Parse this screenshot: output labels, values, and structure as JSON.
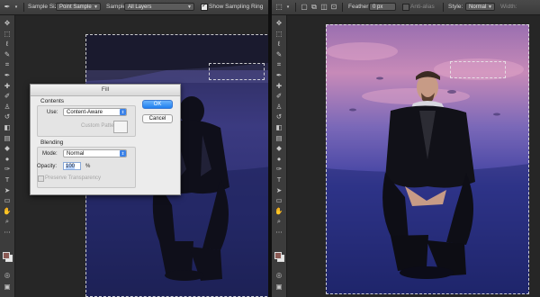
{
  "left_options": {
    "sample_size_label": "Sample Size:",
    "sample_size_value": "Point Sample",
    "sample_label": "Sample:",
    "sample_value": "All Layers",
    "show_ring_label": "Show Sampling Ring"
  },
  "right_options": {
    "feather_label": "Feather:",
    "feather_value": "0 px",
    "anti_alias_label": "Anti-alias",
    "style_label": "Style:",
    "style_value": "Normal",
    "width_label": "Width:"
  },
  "fill_dialog": {
    "title": "Fill",
    "contents_title": "Contents",
    "use_label": "Use:",
    "use_value": "Content-Aware",
    "custom_pattern_label": "Custom Pattern:",
    "blending_title": "Blending",
    "mode_label": "Mode:",
    "mode_value": "Normal",
    "opacity_label": "Opacity:",
    "opacity_value": "100",
    "opacity_unit": "%",
    "preserve_label": "Preserve Transparency",
    "ok_label": "OK",
    "cancel_label": "Cancel"
  },
  "colors": {
    "foreground": "#8a5a54",
    "background": "#e8e8e8",
    "ok_button": "#1f7ff0"
  },
  "tool_icons": [
    "move-icon",
    "marquee-icon",
    "lasso-icon",
    "quick-select-icon",
    "crop-icon",
    "eyedropper-icon",
    "healing-icon",
    "brush-icon",
    "stamp-icon",
    "history-brush-icon",
    "eraser-icon",
    "gradient-icon",
    "blur-icon",
    "dodge-icon",
    "pen-icon",
    "type-icon",
    "path-select-icon",
    "shape-icon",
    "hand-icon",
    "zoom-icon",
    "edit-toolbar-icon"
  ]
}
